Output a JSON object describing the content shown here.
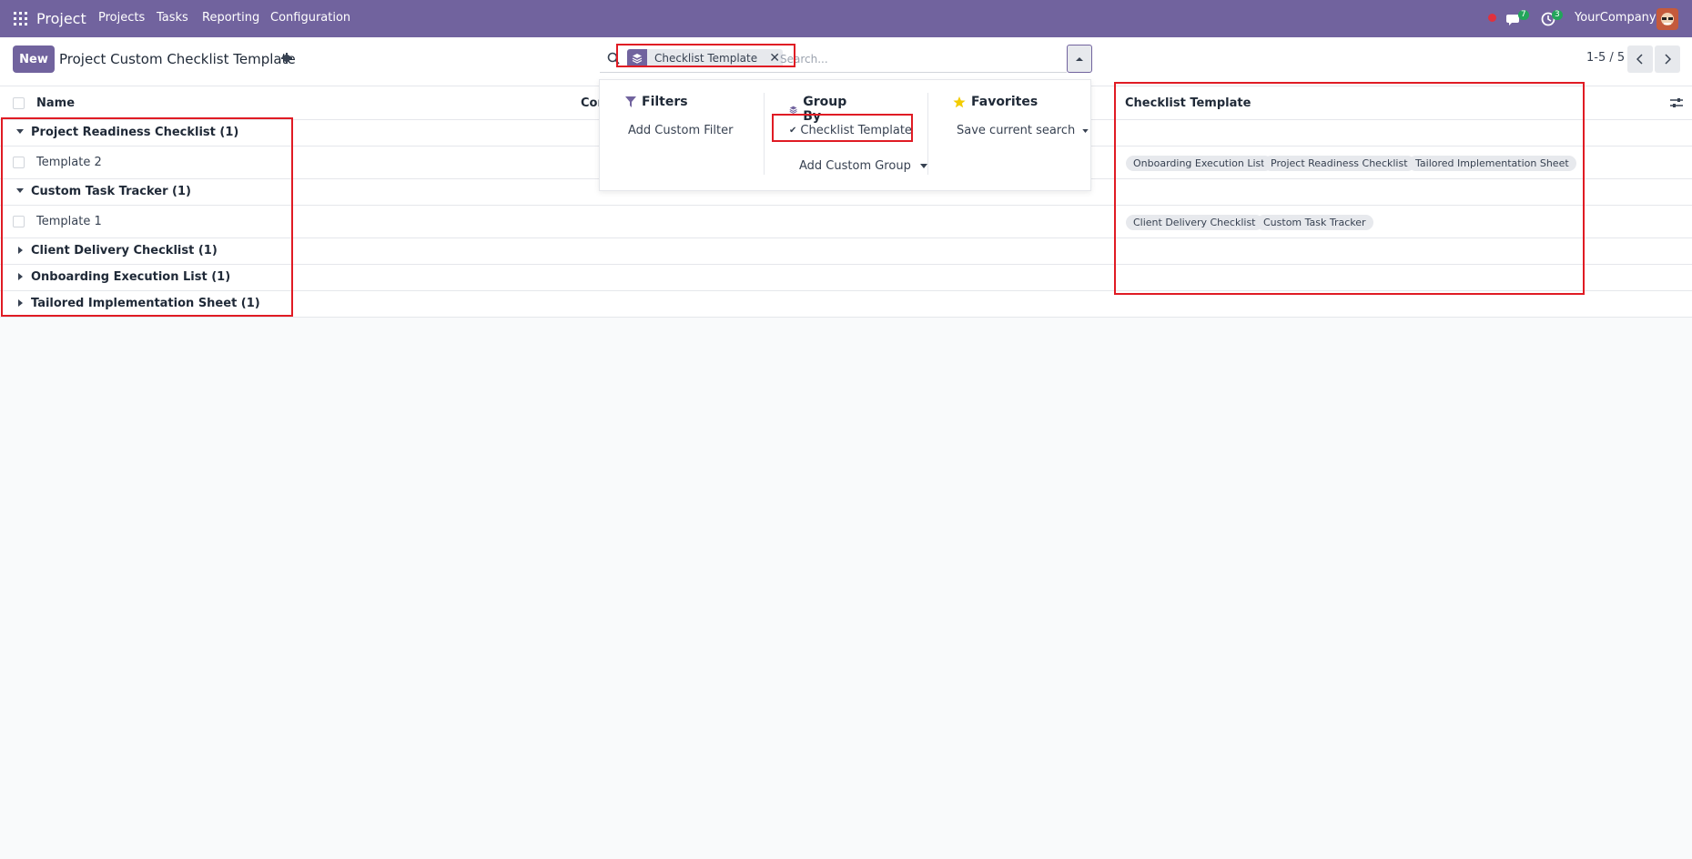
{
  "nav": {
    "app_name": "Project",
    "menus": [
      "Projects",
      "Tasks",
      "Reporting",
      "Configuration"
    ],
    "chat_count": "7",
    "activity_count": "3",
    "company": "YourCompany"
  },
  "control": {
    "new_label": "New",
    "title": "Project Custom Checklist Template",
    "facet_label": "Checklist Template",
    "search_placeholder": "Search...",
    "pager": "1-5 / 5"
  },
  "list": {
    "columns": [
      "Name",
      "Cor",
      "Checklist Template"
    ],
    "groups": [
      {
        "label": "Project Readiness Checklist (1)",
        "expanded": true,
        "rows": [
          {
            "name": "Template 2",
            "tags": [
              "Onboarding Execution List",
              "Project Readiness Checklist",
              "Tailored Implementation Sheet"
            ]
          }
        ]
      },
      {
        "label": "Custom Task Tracker (1)",
        "expanded": true,
        "rows": [
          {
            "name": "Template 1",
            "tags": [
              "Client Delivery Checklist",
              "Custom Task Tracker"
            ]
          }
        ]
      },
      {
        "label": "Client Delivery Checklist (1)",
        "expanded": false
      },
      {
        "label": "Onboarding Execution List (1)",
        "expanded": false
      },
      {
        "label": "Tailored Implementation Sheet (1)",
        "expanded": false
      }
    ]
  },
  "dropdown": {
    "filters_title": "Filters",
    "add_custom_filter": "Add Custom Filter",
    "groupby_title": "Group By",
    "groupby_option": "Checklist Template",
    "add_custom_group": "Add Custom Group",
    "favorites_title": "Favorites",
    "save_current_search": "Save current search"
  },
  "colors": {
    "brand": "#71639e",
    "highlight": "#e01b24",
    "badge": "#22a55a",
    "star": "#f3cc00"
  }
}
